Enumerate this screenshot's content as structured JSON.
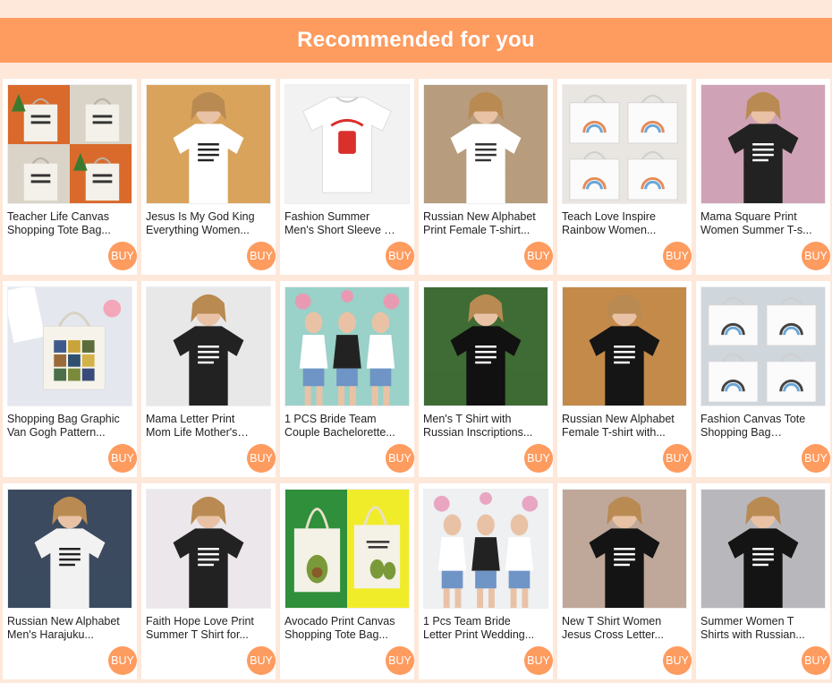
{
  "header": {
    "title": "Recommended for you"
  },
  "colors": {
    "accent": "#fe9b5f",
    "page_bg": "#fde8da",
    "card_bg": "#ffffff"
  },
  "products": [
    {
      "title": "Teacher Life Canvas Shopping Tote Bag...",
      "buy_label": "BUY",
      "image_kind": "tote-collage",
      "palette": [
        "#d96a2c",
        "#f4f1ea",
        "#3b7a2e"
      ]
    },
    {
      "title": "Jesus Is My God King Everything Women...",
      "buy_label": "BUY",
      "image_kind": "person-shirt",
      "palette": [
        "#d9a35c",
        "#ffffff",
        "#222222"
      ]
    },
    {
      "title": "Fashion Summer Men's Short Sleeve T Shirts...",
      "buy_label": "BUY",
      "image_kind": "flat-shirt",
      "palette": [
        "#f2f2f2",
        "#ffffff",
        "#d9302c"
      ]
    },
    {
      "title": "Russian New Alphabet Print Female T-shirt...",
      "buy_label": "BUY",
      "image_kind": "person-shirt",
      "palette": [
        "#b79c7d",
        "#ffffff",
        "#333333"
      ]
    },
    {
      "title": "Teach Love Inspire Rainbow Women...",
      "buy_label": "BUY",
      "image_kind": "tote-grid",
      "palette": [
        "#e9e6e2",
        "#fbfbfb",
        "#e58b5a"
      ]
    },
    {
      "title": "Mama Square Print Women Summer T-s...",
      "buy_label": "BUY",
      "image_kind": "person-shirt",
      "palette": [
        "#cfa3b5",
        "#222222",
        "#ffffff"
      ]
    },
    {
      "title": "Shopping Bag Graphic Van Gogh Pattern...",
      "buy_label": "BUY",
      "image_kind": "tote-single",
      "palette": [
        "#e5e7ef",
        "#f6f3ea",
        "#5a6d3a"
      ]
    },
    {
      "title": "Mama Letter Print Mom Life Mother's Day Mu...",
      "buy_label": "BUY",
      "image_kind": "person-shirt",
      "palette": [
        "#e8e8e8",
        "#222222",
        "#ffffff"
      ]
    },
    {
      "title": "1 PCS Bride Team Couple Bachelorette...",
      "buy_label": "BUY",
      "image_kind": "group-shirts",
      "palette": [
        "#9ad1c8",
        "#ffffff",
        "#e89ab3"
      ]
    },
    {
      "title": "Men's T Shirt with Russian Inscriptions...",
      "buy_label": "BUY",
      "image_kind": "person-shirt",
      "palette": [
        "#3f6b34",
        "#111111",
        "#ffffff"
      ]
    },
    {
      "title": "Russian New Alphabet Female T-shirt with...",
      "buy_label": "BUY",
      "image_kind": "person-shirt",
      "palette": [
        "#c48a4a",
        "#151515",
        "#ffffff"
      ]
    },
    {
      "title": "Fashion Canvas Tote Shopping Bag Wome...",
      "buy_label": "BUY",
      "image_kind": "tote-grid",
      "palette": [
        "#cfd6dc",
        "#fbfbfb",
        "#444444"
      ]
    },
    {
      "title": "Russian New Alphabet Men's Harajuku...",
      "buy_label": "BUY",
      "image_kind": "person-shirt",
      "palette": [
        "#3b4a5f",
        "#f2f2f2",
        "#222222"
      ]
    },
    {
      "title": "Faith Hope Love Print Summer T Shirt for...",
      "buy_label": "BUY",
      "image_kind": "person-shirt",
      "palette": [
        "#ece7ea",
        "#222222",
        "#ffffff"
      ]
    },
    {
      "title": "Avocado Print Canvas Shopping Tote Bag...",
      "buy_label": "BUY",
      "image_kind": "tote-pair",
      "palette": [
        "#2f8f3a",
        "#f1ec2a",
        "#f4f1e6"
      ]
    },
    {
      "title": "1 Pcs Team Bride Letter Print Wedding...",
      "buy_label": "BUY",
      "image_kind": "group-shirts",
      "palette": [
        "#eef0f2",
        "#ffffff",
        "#e8a6c2"
      ]
    },
    {
      "title": "New T Shirt Women Jesus Cross Letter...",
      "buy_label": "BUY",
      "image_kind": "person-shirt",
      "palette": [
        "#bfa89a",
        "#141414",
        "#ffffff"
      ]
    },
    {
      "title": "Summer Women T Shirts with Russian...",
      "buy_label": "BUY",
      "image_kind": "person-shirt",
      "palette": [
        "#b8b8bc",
        "#141414",
        "#ffffff"
      ]
    }
  ]
}
